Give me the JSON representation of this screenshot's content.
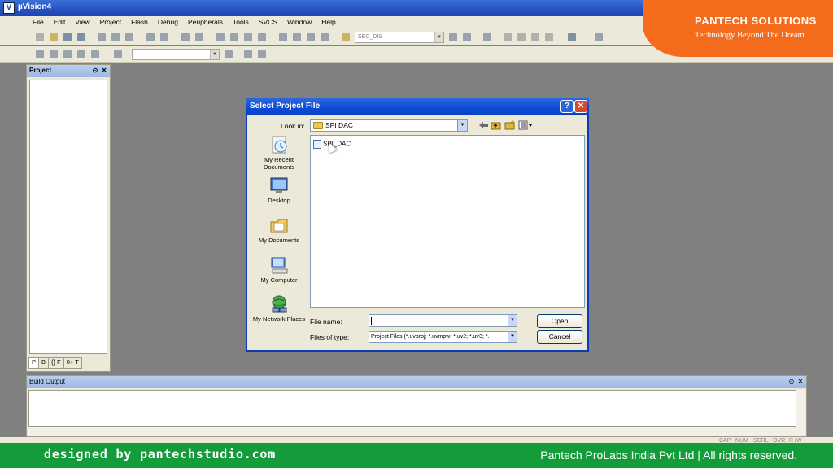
{
  "window": {
    "title": "µVision4",
    "icon_letter": "V"
  },
  "menu": [
    "File",
    "Edit",
    "View",
    "Project",
    "Flash",
    "Debug",
    "Peripherals",
    "Tools",
    "SVCS",
    "Window",
    "Help"
  ],
  "toolbar": {
    "target_combo": "SEC_DIS",
    "target_combo2": ""
  },
  "logo": {
    "brand": "PANTECH SOLUTIONS",
    "tagline": "Technology Beyond The Dream"
  },
  "project_panel": {
    "title": "Project",
    "tabs": [
      "P",
      "B",
      "{} F",
      "0+ T"
    ]
  },
  "build_output": {
    "title": "Build Output"
  },
  "statusbar": {
    "indicators": [
      "CAP",
      "NUM",
      "SCRL",
      "OVR",
      "R /W"
    ]
  },
  "dialog": {
    "title": "Select Project File",
    "look_in_label": "Look in:",
    "look_in_value": "SPI DAC",
    "places": [
      {
        "label": "My Recent Documents",
        "icon": "recent-documents-icon"
      },
      {
        "label": "Desktop",
        "icon": "desktop-icon"
      },
      {
        "label": "My Documents",
        "icon": "my-documents-icon"
      },
      {
        "label": "My Computer",
        "icon": "my-computer-icon"
      },
      {
        "label": "My Network Places",
        "icon": "network-places-icon"
      }
    ],
    "files": [
      {
        "name": "SPI_DAC",
        "icon": "uvproj-file-icon"
      }
    ],
    "file_name_label": "File name:",
    "file_name_value": "",
    "file_type_label": "Files of type:",
    "file_type_value": "Project Files (*.uvproj; *.uvmpw; *.uv2; *.uv3; *.",
    "open_label": "Open",
    "cancel_label": "Cancel"
  },
  "banner": {
    "left": "designed by pantechstudio.com",
    "right": "Pantech ProLabs India Pvt Ltd | All rights reserved.",
    "color": "#149c3a"
  }
}
